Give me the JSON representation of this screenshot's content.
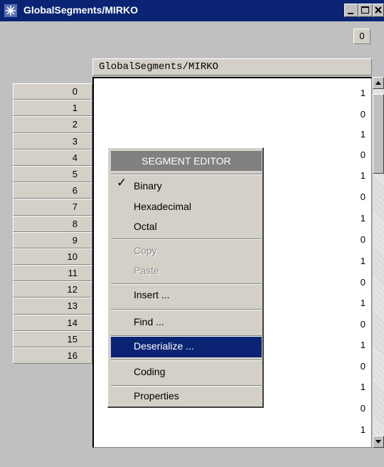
{
  "window": {
    "title": "GlobalSegments/MIRKO",
    "counter": "0"
  },
  "table": {
    "header": "GlobalSegments/MIRKO",
    "row_numbers": [
      "0",
      "1",
      "2",
      "3",
      "4",
      "5",
      "6",
      "7",
      "8",
      "9",
      "10",
      "11",
      "12",
      "13",
      "14",
      "15",
      "16"
    ],
    "values": [
      "1",
      "0",
      "1",
      "0",
      "1",
      "0",
      "1",
      "0",
      "1",
      "0",
      "1",
      "0",
      "1",
      "0",
      "1",
      "0",
      "1"
    ]
  },
  "context_menu": {
    "title": "SEGMENT EDITOR",
    "items": {
      "binary": "Binary",
      "hexadecimal": "Hexadecimal",
      "octal": "Octal",
      "copy": "Copy",
      "paste": "Paste",
      "insert": "Insert ...",
      "find": "Find ...",
      "deserialize": "Deserialize ...",
      "coding": "Coding",
      "properties": "Properties"
    },
    "checked_item": "Binary",
    "selected_item": "Deserialize ..."
  },
  "colors": {
    "title_bar": "#0a2473",
    "menu_highlight": "#0a2473",
    "menu_title_bg": "#808080",
    "surface": "#c0c0c0"
  }
}
